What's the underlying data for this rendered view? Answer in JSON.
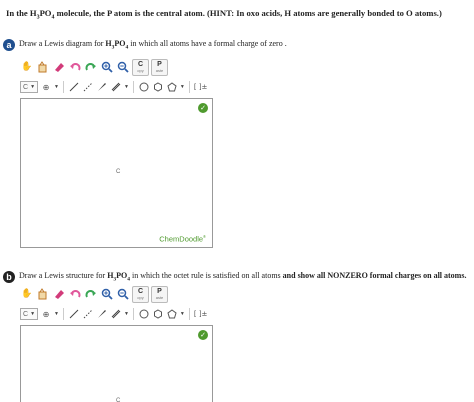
{
  "intro": {
    "p1": "In the H",
    "s1": "3",
    "p2": "PO",
    "s2": "4",
    "p3": " molecule, the P atom is the central atom. (HINT: In oxo acids, H atoms are generally bonded to O atoms.)"
  },
  "part_a": {
    "badge": "a",
    "p1": "Draw a Lewis diagram for ",
    "f1": "H",
    "s1": "3",
    "f2": "PO",
    "s2": "4",
    "p2": " in which all atoms have a formal charge of zero ."
  },
  "part_b": {
    "badge": "b",
    "p1": "Draw a Lewis structure for ",
    "f1": "H",
    "s1": "3",
    "f2": "PO",
    "s2": "4",
    "p2": " in which the octet rule is satisfied on all atoms ",
    "bold": "and show all NONZERO formal charges on all atoms."
  },
  "toolbar": {
    "copy_letter": "C",
    "copy_label": "opy",
    "paste_letter": "P",
    "paste_label": "aste",
    "element_value": "C",
    "bracket_label": "[ ]±",
    "colors": {
      "lasso": "#c07a2a",
      "eraser": "#d23b7a",
      "undo": "#e0579a",
      "redo": "#3aa655",
      "zoom": "#2f5fa8",
      "clean": "#4f9a2e"
    }
  },
  "canvas": {
    "atom_label": "C",
    "brand": "ChemDoodle",
    "brand_mark": "®",
    "clean_glyph": "✓"
  }
}
